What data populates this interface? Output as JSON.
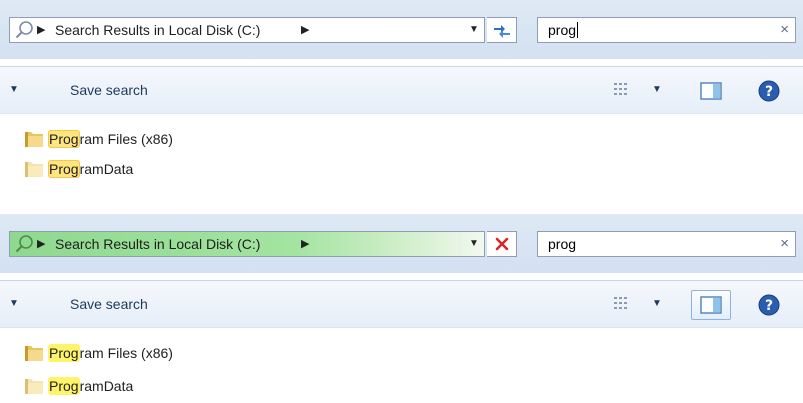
{
  "panels": [
    {
      "address": {
        "separator_icon": "triangle-right",
        "crumb": "Search Results in Local Disk (C:)",
        "dropdown_icon": "chevron-down-icon"
      },
      "nav_button_icon": "refresh-icon",
      "search": {
        "value": "prog",
        "clear_icon": "×",
        "focused": true
      },
      "command_bar": {
        "save_search": "Save search",
        "views_icon": "views-icon",
        "preview_pane_icon": "preview-pane-icon",
        "help_icon": "help-icon"
      },
      "items": [
        {
          "match": "Prog",
          "rest": "ram Files (x86)"
        },
        {
          "match": "Prog",
          "rest": "ramData"
        }
      ]
    },
    {
      "address": {
        "separator_icon": "triangle-right",
        "crumb": "Search Results in Local Disk (C:)",
        "dropdown_icon": "chevron-down-icon"
      },
      "nav_button_icon": "stop-icon",
      "search": {
        "value": "prog",
        "clear_icon": "×",
        "focused": false
      },
      "command_bar": {
        "save_search": "Save search",
        "views_icon": "views-icon",
        "preview_pane_icon": "preview-pane-icon",
        "help_icon": "help-icon"
      },
      "items": [
        {
          "match": "Prog",
          "rest": "ram Files (x86)"
        },
        {
          "match": "Prog",
          "rest": "ramData"
        }
      ]
    }
  ],
  "colors": {
    "match_highlight_top": "#ffe580",
    "match_highlight_bottom": "#fff36b",
    "search_progress": "#8fd98f",
    "stop_red": "#d8282c",
    "help_blue": "#2a5cb0"
  }
}
